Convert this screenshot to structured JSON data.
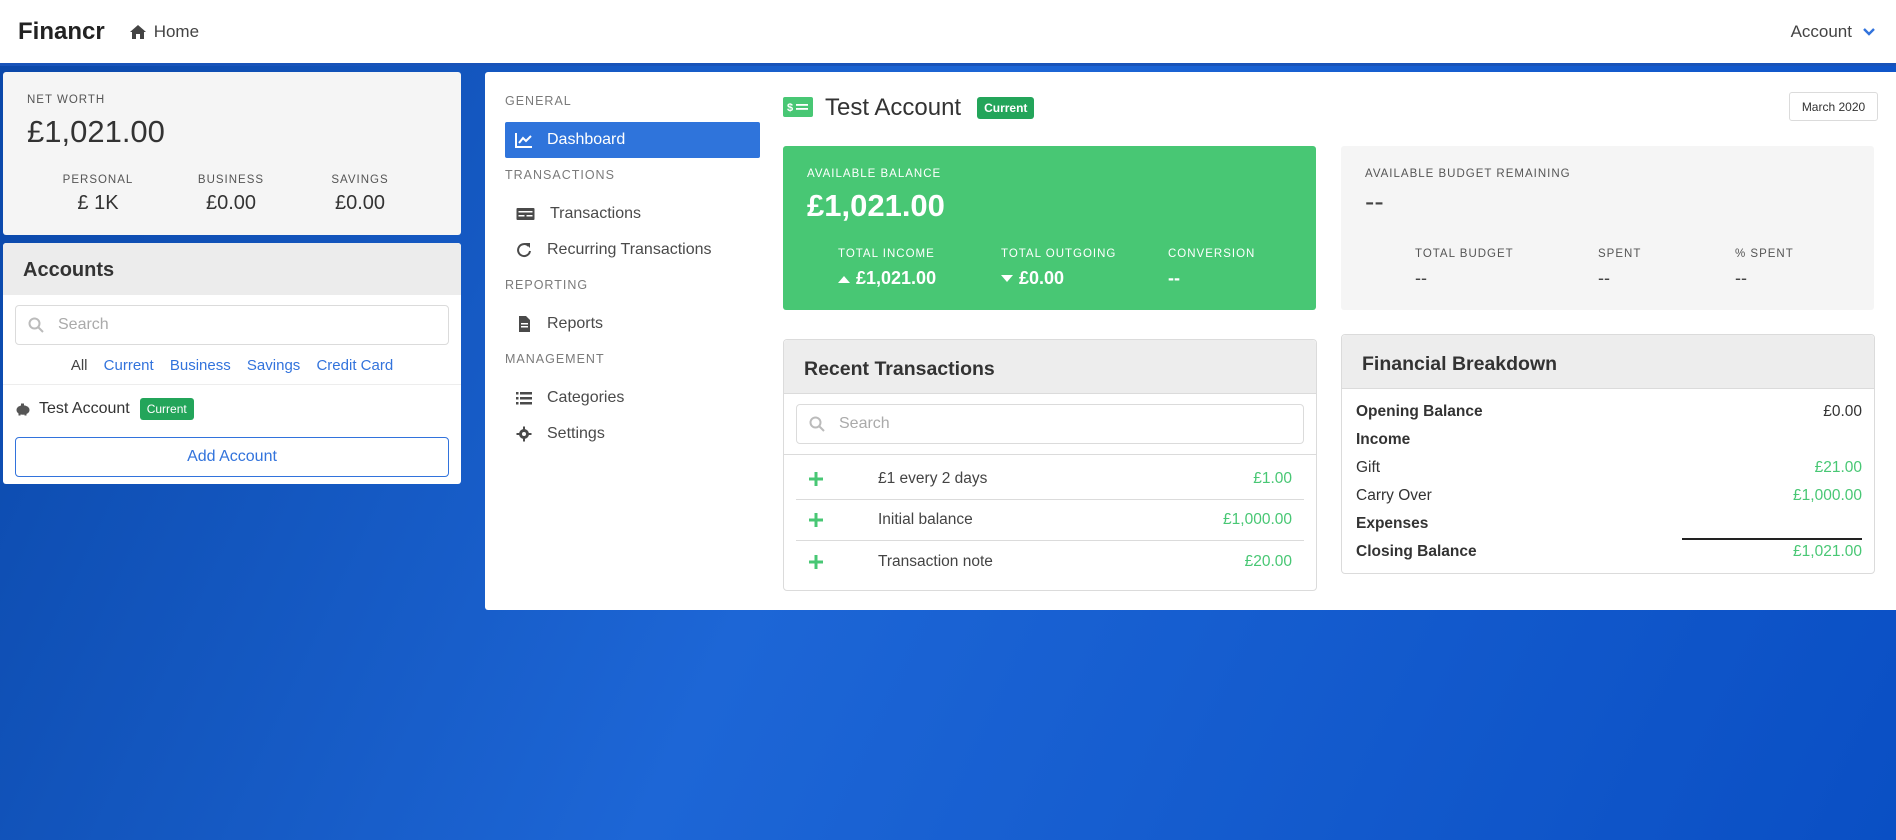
{
  "navbar": {
    "brand": "Financr",
    "home_label": "Home",
    "account_label": "Account"
  },
  "net_worth": {
    "label": "NET WORTH",
    "value": "£1,021.00",
    "stats": [
      {
        "label": "PERSONAL",
        "value": "£ 1K"
      },
      {
        "label": "BUSINESS",
        "value": "£0.00"
      },
      {
        "label": "SAVINGS",
        "value": "£0.00"
      }
    ]
  },
  "accounts": {
    "title": "Accounts",
    "search_placeholder": "Search",
    "filters": [
      "All",
      "Current",
      "Business",
      "Savings",
      "Credit Card"
    ],
    "items": [
      {
        "name": "Test Account",
        "tag": "Current"
      }
    ],
    "add_label": "Add Account"
  },
  "menu": {
    "groups": [
      {
        "label": "GENERAL",
        "items": [
          {
            "label": "Dashboard",
            "icon": "chart-line-icon",
            "active": true
          }
        ]
      },
      {
        "label": "TRANSACTIONS",
        "items": [
          {
            "label": "Transactions",
            "icon": "money-check-icon"
          },
          {
            "label": "Recurring Transactions",
            "icon": "redo-icon"
          }
        ]
      },
      {
        "label": "REPORTING",
        "items": [
          {
            "label": "Reports",
            "icon": "file-icon"
          }
        ]
      },
      {
        "label": "MANAGEMENT",
        "items": [
          {
            "label": "Categories",
            "icon": "list-icon"
          },
          {
            "label": "Settings",
            "icon": "gear-icon"
          }
        ]
      }
    ]
  },
  "account_header": {
    "name": "Test Account",
    "tag": "Current",
    "month": "March 2020"
  },
  "balance": {
    "label": "AVAILABLE BALANCE",
    "value": "£1,021.00",
    "stats": [
      {
        "label": "TOTAL INCOME",
        "value": "£1,021.00",
        "icon": "caret-up-icon"
      },
      {
        "label": "TOTAL OUTGOING",
        "value": "£0.00",
        "icon": "caret-down-icon"
      },
      {
        "label": "CONVERSION",
        "value": "--"
      }
    ]
  },
  "budget": {
    "label": "AVAILABLE BUDGET REMAINING",
    "value": "--",
    "stats": [
      {
        "label": "TOTAL BUDGET",
        "value": "--"
      },
      {
        "label": "SPENT",
        "value": "--"
      },
      {
        "label": "% SPENT",
        "value": "--"
      }
    ]
  },
  "recent": {
    "title": "Recent Transactions",
    "search_placeholder": "Search",
    "rows": [
      {
        "note": "£1 every 2 days",
        "amount": "£1.00"
      },
      {
        "note": "Initial balance",
        "amount": "£1,000.00"
      },
      {
        "note": "Transaction note",
        "amount": "£20.00"
      }
    ]
  },
  "breakdown": {
    "title": "Financial Breakdown",
    "opening_label": "Opening Balance",
    "opening_value": "£0.00",
    "income_label": "Income",
    "income_items": [
      {
        "label": "Gift",
        "value": "£21.00"
      },
      {
        "label": "Carry Over",
        "value": "£1,000.00"
      }
    ],
    "expenses_label": "Expenses",
    "closing_label": "Closing Balance",
    "closing_value": "£1,021.00"
  },
  "colors": {
    "primary": "#3273dc",
    "success": "#48c774",
    "tag_green": "#23a55a",
    "menu_active": "#2f74db"
  }
}
